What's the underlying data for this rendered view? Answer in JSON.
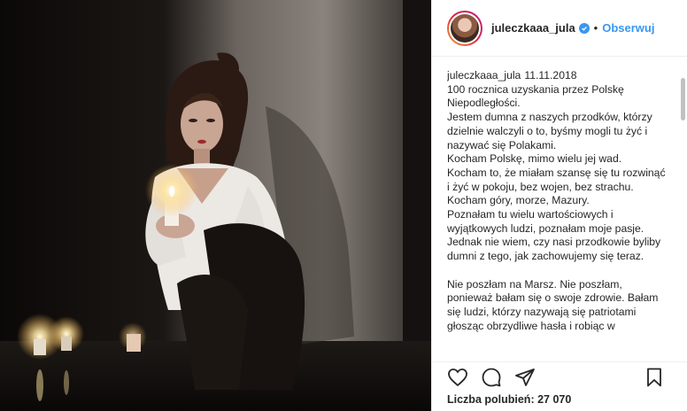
{
  "post": {
    "username": "juleczkaaa_jula",
    "follow_label": "Obserwuj",
    "separator": "•",
    "caption": {
      "username": "juleczkaaa_jula",
      "date": "11.11.2018",
      "text": "100 rocznica uzyskania przez Polskę Niepodległości.\nJestem dumna z naszych przodków, którzy dzielnie walczyli o to, byśmy mogli tu żyć i nazywać się Polakami.\nKocham Polskę, mimo wielu jej wad.\nKocham to, że miałam szansę się tu rozwinąć i żyć w pokoju, bez wojen, bez strachu.\nKocham góry, morze, Mazury.\nPoznałam tu wielu wartościowych i wyjątkowych ludzi, poznałam moje pasje.\nJednak nie wiem, czy nasi przodkowie byliby dumni z tego, jak zachowujemy się teraz.\n\nNie poszłam na Marsz. Nie poszłam, ponieważ bałam się o swoje zdrowie. Bałam się ludzi, którzy nazywają się patriotami głosząc obrzydliwe hasła i robiąc w"
    },
    "likes_text": "Liczba polubień: 27 070",
    "icons": {
      "verified": "verified-badge-icon",
      "like": "heart-icon",
      "comment": "comment-bubble-icon",
      "share": "share-icon",
      "save": "bookmark-icon"
    },
    "colors": {
      "accent": "#3897f0",
      "text": "#262626",
      "border": "#efefef"
    }
  }
}
